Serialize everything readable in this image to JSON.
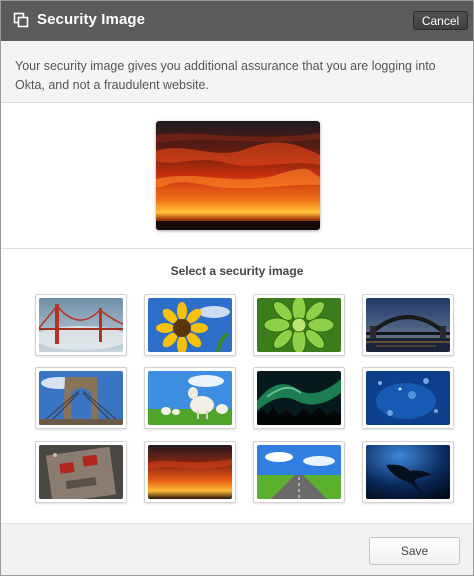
{
  "dialog": {
    "title": "Security Image",
    "header_icon": "copy-windows-icon",
    "cancel_label": "Cancel",
    "description": "Your security image gives you additional assurance that you are logging into Okta, and not a fraudulent website.",
    "selected_image": "red-sunset-sky",
    "select_prompt": "Select a security image",
    "images": [
      {
        "subject": "golden-gate-bridge-fog"
      },
      {
        "subject": "sunflower"
      },
      {
        "subject": "green-succulent"
      },
      {
        "subject": "sydney-harbour-bridge-night"
      },
      {
        "subject": "brooklyn-bridge"
      },
      {
        "subject": "lambs-in-field"
      },
      {
        "subject": "aurora-borealis"
      },
      {
        "subject": "blue-underwater-bubbles"
      },
      {
        "subject": "robot-face"
      },
      {
        "subject": "red-sunset-sky"
      },
      {
        "subject": "road-through-fields"
      },
      {
        "subject": "manta-ray"
      }
    ],
    "save_label": "Save"
  }
}
